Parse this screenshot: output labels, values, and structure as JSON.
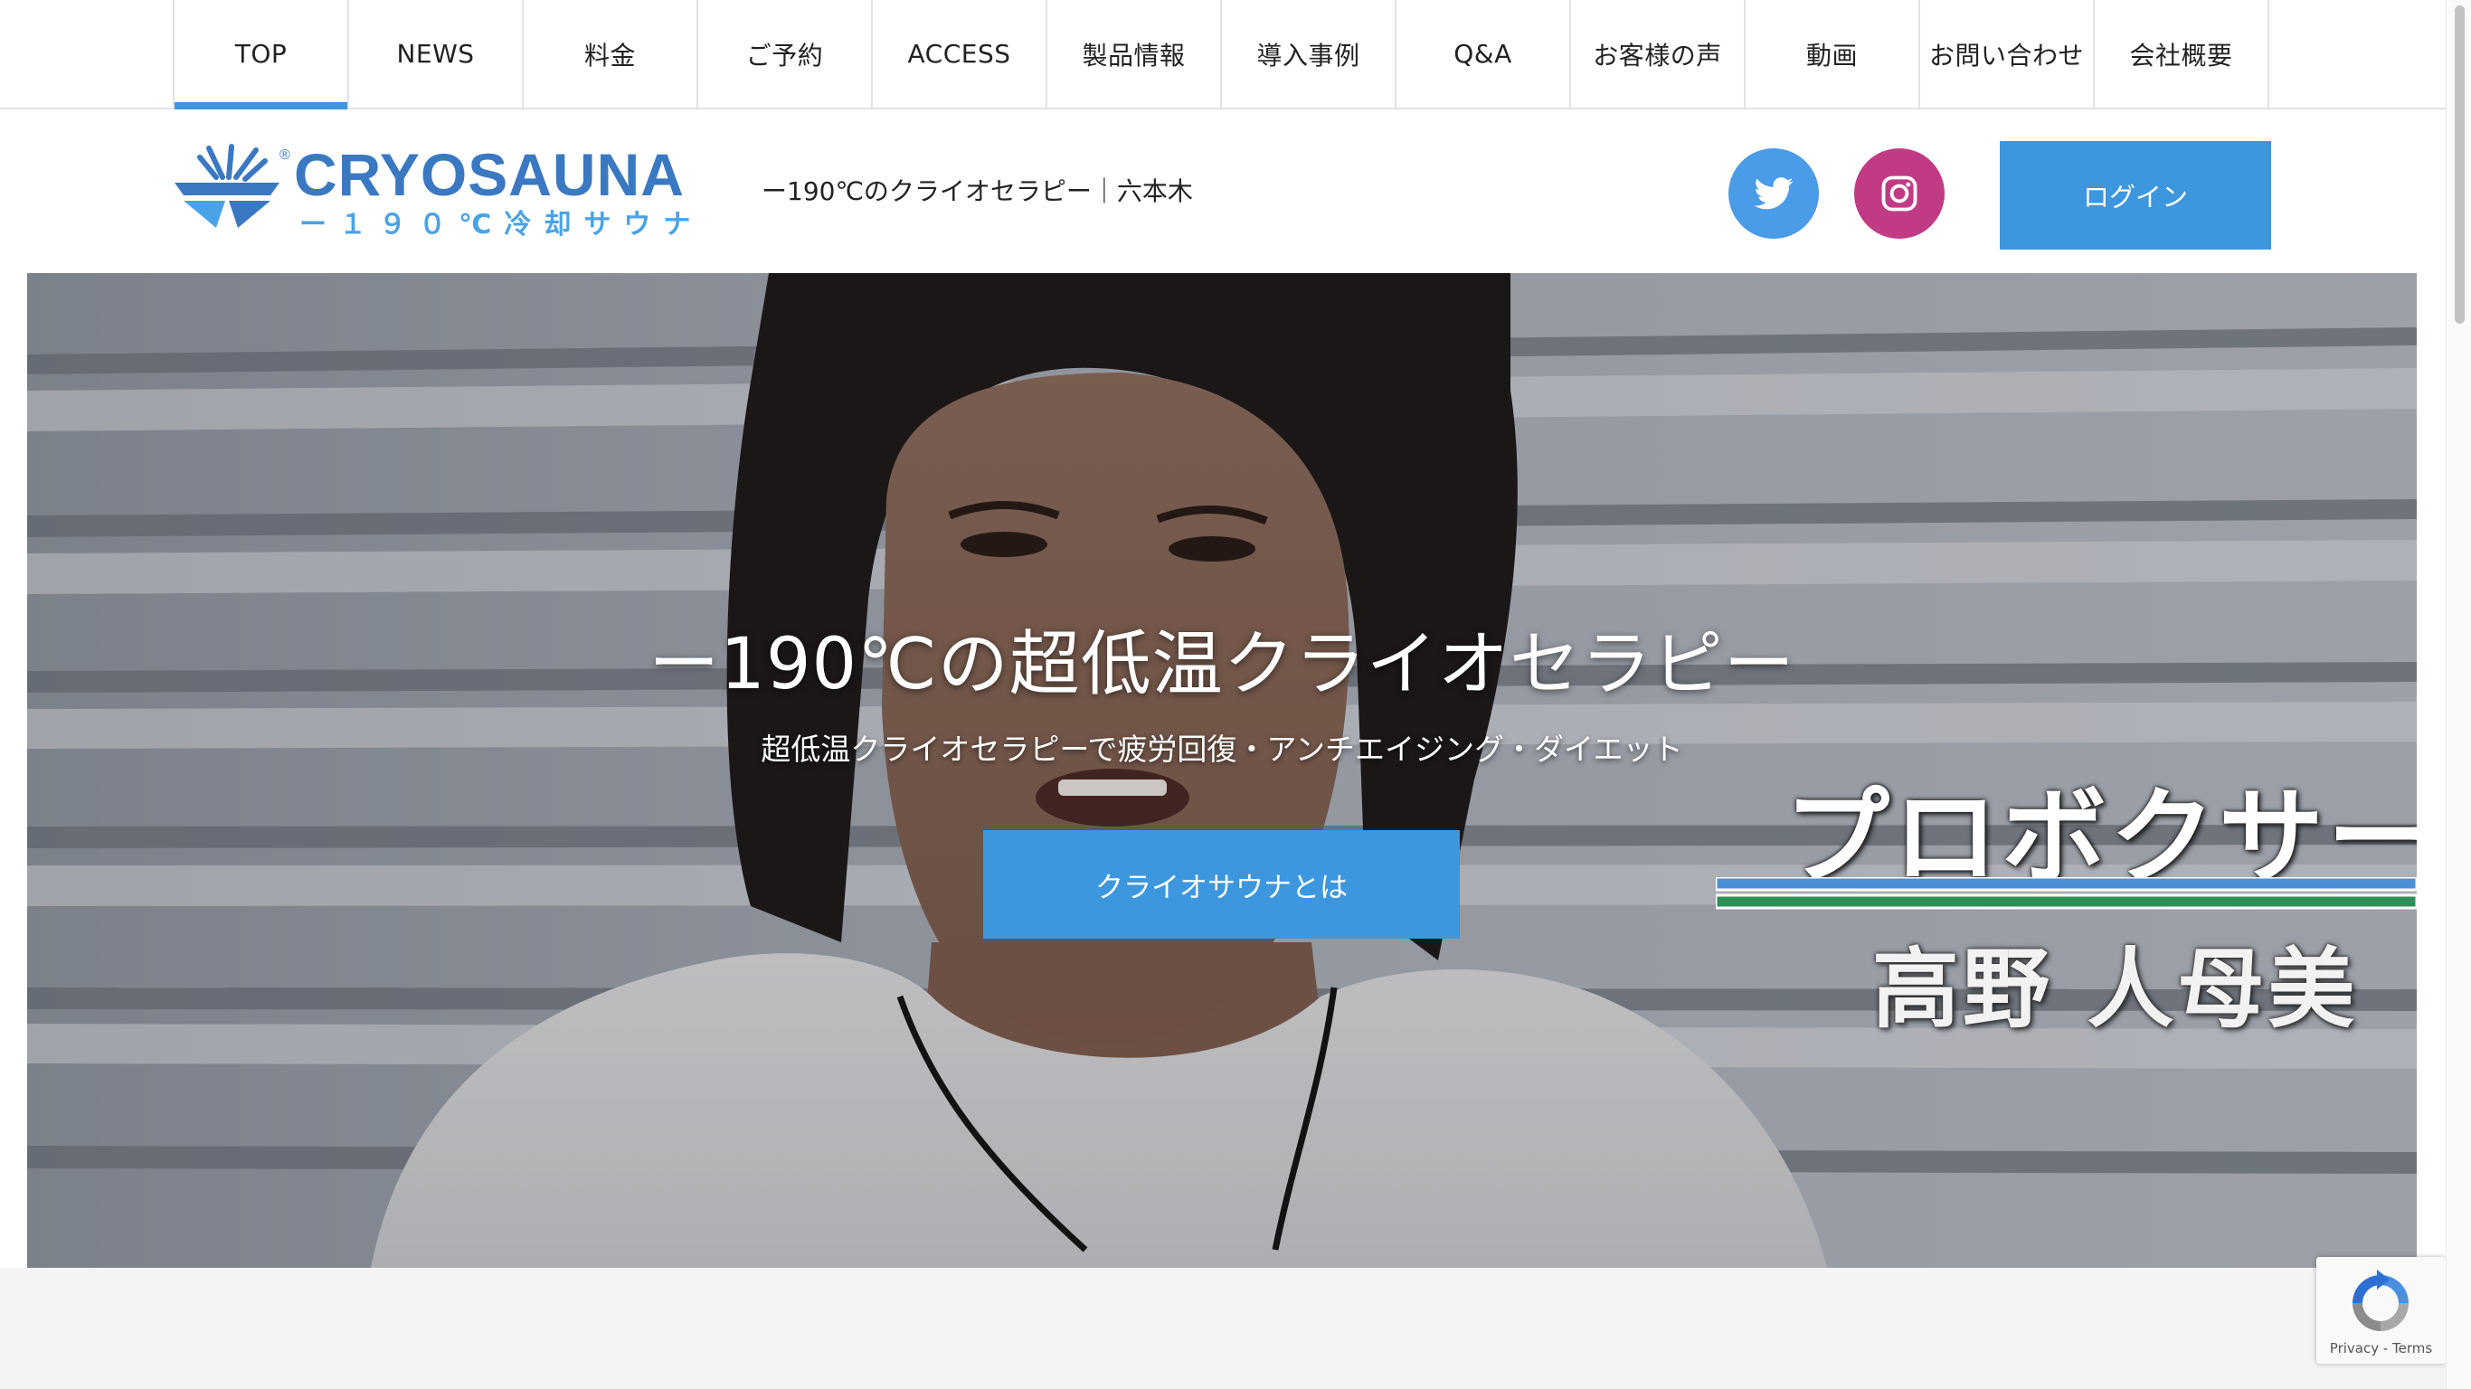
{
  "nav": {
    "items": [
      {
        "label": "TOP",
        "active": true
      },
      {
        "label": "NEWS"
      },
      {
        "label": "料金"
      },
      {
        "label": "ご予約"
      },
      {
        "label": "ACCESS"
      },
      {
        "label": "製品情報"
      },
      {
        "label": "導入事例"
      },
      {
        "label": "Q&A"
      },
      {
        "label": "お客様の声"
      },
      {
        "label": "動画"
      },
      {
        "label": "お問い合わせ"
      },
      {
        "label": "会社概要"
      }
    ]
  },
  "header": {
    "logo": {
      "brand": "CRYOSAUNA",
      "subtitle": "ー１９０℃冷却サウナ",
      "registered_mark": "®",
      "icon": "snowflake-sauna-logo"
    },
    "tagline": "ー190℃のクライオセラピー｜六本木",
    "social": [
      {
        "name": "twitter",
        "icon": "twitter-bird-icon",
        "color": "#4a9be8"
      },
      {
        "name": "instagram",
        "icon": "instagram-camera-icon",
        "color": "#c13b84"
      }
    ],
    "login_label": "ログイン"
  },
  "hero": {
    "title": "ー190℃の超低温クライオセラピー",
    "subtitle": "超低温クライオセラピーで疲労回復・アンチエイジング・ダイエット",
    "cta_label": "クライオサウナとは",
    "caption_role": "プロボクサー",
    "caption_name": "高野 人母美"
  },
  "recaptcha": {
    "text": "Privacy - Terms"
  },
  "colors": {
    "accent": "#3d97de",
    "brand_blue": "#3a78c2",
    "nav_border": "#e3e3e3"
  }
}
